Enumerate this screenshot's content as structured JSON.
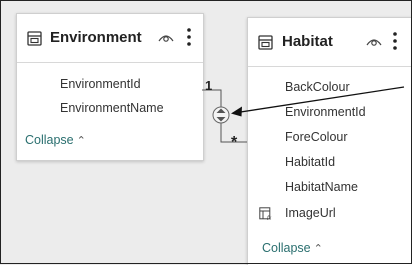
{
  "tables": [
    {
      "name": "Environment",
      "fields": [
        "EnvironmentId",
        "EnvironmentName"
      ],
      "collapse_label": "Collapse",
      "collapse_icon": "chevron-up-icon"
    },
    {
      "name": "Habitat",
      "fields": [
        "BackColour",
        "EnvironmentId",
        "ForeColour",
        "HabitatId",
        "HabitatName",
        "ImageUrl"
      ],
      "computed_field_icon": "calculated-column-icon",
      "collapse_label": "Collapse",
      "collapse_icon": "chevron-up-icon"
    }
  ],
  "relationship": {
    "one_side": "1",
    "many_side": "*",
    "filter_direction_icon": "bidirectional-filter-icon"
  },
  "colors": {
    "accent": "#2a6f6f",
    "background": "#ececec",
    "card": "#ffffff"
  }
}
